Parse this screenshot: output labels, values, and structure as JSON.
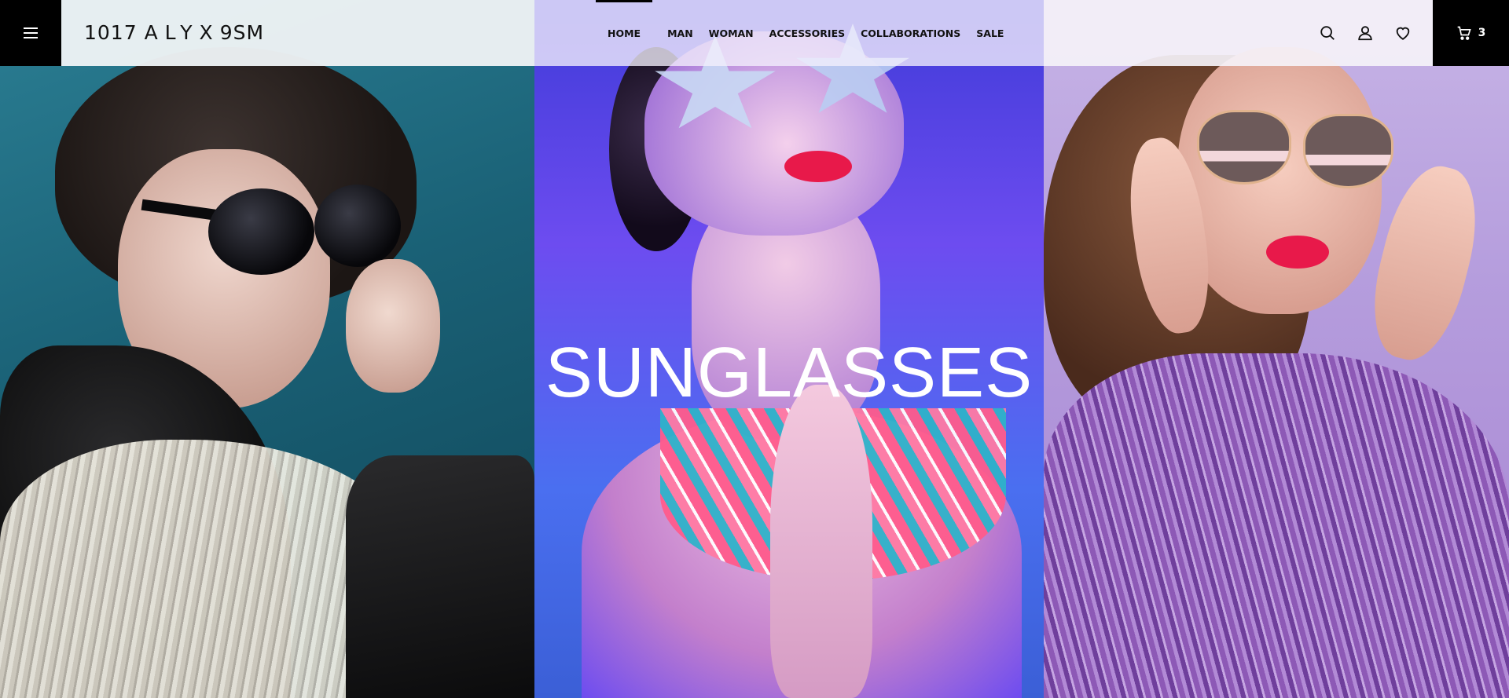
{
  "brand": {
    "logo_text_a": "1017",
    "logo_text_b": "ALYX",
    "logo_text_c": "9SM"
  },
  "nav": {
    "items": [
      {
        "label": "HOME",
        "active": true
      },
      {
        "label": "MAN"
      },
      {
        "label": "WOMAN"
      },
      {
        "label": "ACCESSORIES"
      },
      {
        "label": "COLLABORATIONS"
      },
      {
        "label": "SALE"
      }
    ]
  },
  "header_icons": {
    "menu": "hamburger-menu-icon",
    "search": "search-icon",
    "account": "user-icon",
    "wishlist": "heart-icon",
    "cart": "cart-icon"
  },
  "cart": {
    "count": "3"
  },
  "hero": {
    "title": "SUNGLASSES",
    "panels": [
      {
        "name": "woman-with-spiked-sunglasses",
        "bg": "#1a6176"
      },
      {
        "name": "woman-with-star-sunglasses",
        "bg": "#5a47e8"
      },
      {
        "name": "woman-with-cat-eye-sunglasses",
        "bg": "#b59ddd"
      }
    ]
  },
  "colors": {
    "header_dark": "#000000",
    "text_dark": "#111111",
    "hero_text": "#ffffff"
  }
}
